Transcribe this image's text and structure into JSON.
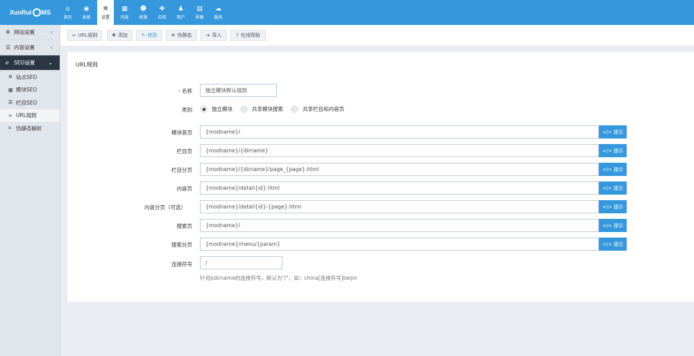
{
  "logo": {
    "text_a": "XunRui",
    "text_b": "MS"
  },
  "topnav": [
    {
      "label": "首页",
      "icon": "home-icon",
      "glyph": "⌂"
    },
    {
      "label": "系统",
      "icon": "globe-icon",
      "glyph": "◉"
    },
    {
      "label": "设置",
      "icon": "cogs-icon",
      "glyph": "✲"
    },
    {
      "label": "内容",
      "icon": "grid-icon",
      "glyph": "▦"
    },
    {
      "label": "权限",
      "icon": "user-circle-icon",
      "glyph": "☻"
    },
    {
      "label": "应用",
      "icon": "puzzle-icon",
      "glyph": "✚"
    },
    {
      "label": "用户",
      "icon": "user-icon",
      "glyph": "♟"
    },
    {
      "label": "界面",
      "icon": "file-icon",
      "glyph": "▤"
    },
    {
      "label": "服务",
      "icon": "cloud-icon",
      "glyph": "☁"
    }
  ],
  "sidebar": {
    "groups": [
      {
        "label": "网站设置",
        "icon": "cog-icon",
        "glyph": "✲",
        "arrow": "‹"
      },
      {
        "label": "内容设置",
        "icon": "list-icon",
        "glyph": "☰",
        "arrow": "‹"
      },
      {
        "label": "SEO设置",
        "icon": "internet-explorer-icon",
        "glyph": "ℯ",
        "arrow": "⌄"
      }
    ],
    "items": [
      {
        "label": "站点SEO",
        "icon": "cog-icon",
        "glyph": "✲"
      },
      {
        "label": "模块SEO",
        "icon": "th-large-icon",
        "glyph": "▦"
      },
      {
        "label": "栏目SEO",
        "icon": "reorder-icon",
        "glyph": "☰"
      },
      {
        "label": "URL规则",
        "icon": "link-icon",
        "glyph": "∞"
      },
      {
        "label": "伪静态解析",
        "icon": "code-icon",
        "glyph": "⌗"
      }
    ]
  },
  "toolbar": [
    {
      "label": "URL规则",
      "icon": "link-icon",
      "glyph": "∞"
    },
    {
      "label": "添加",
      "icon": "plus-icon",
      "glyph": "✚"
    },
    {
      "label": "修改",
      "icon": "edit-icon",
      "glyph": "✎"
    },
    {
      "label": "伪静态",
      "icon": "cog-icon",
      "glyph": "✲"
    },
    {
      "label": "导入",
      "icon": "sign-in-icon",
      "glyph": "➜"
    },
    {
      "label": "在线帮助",
      "icon": "question-icon",
      "glyph": "?"
    }
  ],
  "form": {
    "title": "URL规则",
    "name_label": "名称",
    "name_value": "独立模块默认规则",
    "type_label": "类别",
    "type_options": [
      "独立模块",
      "共享模块搜索",
      "共享栏目和内容页"
    ],
    "addon_label": "提示",
    "addon_glyph": "</>",
    "rows": [
      {
        "label": "模块首页",
        "value": "{modname}/"
      },
      {
        "label": "栏目页",
        "value": "{modname}/{dirname}"
      },
      {
        "label": "栏目分页",
        "value": "{modname}/{dirname}/page_{page}.html"
      },
      {
        "label": "内容页",
        "value": "{modname}/detail{id}.html"
      },
      {
        "label": "内容分页（可选）",
        "value": "{modname}/detail{id}-{page}.html"
      },
      {
        "label": "搜索页",
        "value": "{modname}/"
      },
      {
        "label": "搜索分页",
        "value": "{modname}/menu/{param}"
      }
    ],
    "sep_label": "连接符号",
    "sep_value": "/",
    "sep_help": "针对pdirname的连接符号，默认为\"/\"，如：china[连接符号]beijin"
  },
  "colors": {
    "primary": "#3598dc",
    "sidebar_active": "#2b3643",
    "background": "#e9ecf3"
  }
}
